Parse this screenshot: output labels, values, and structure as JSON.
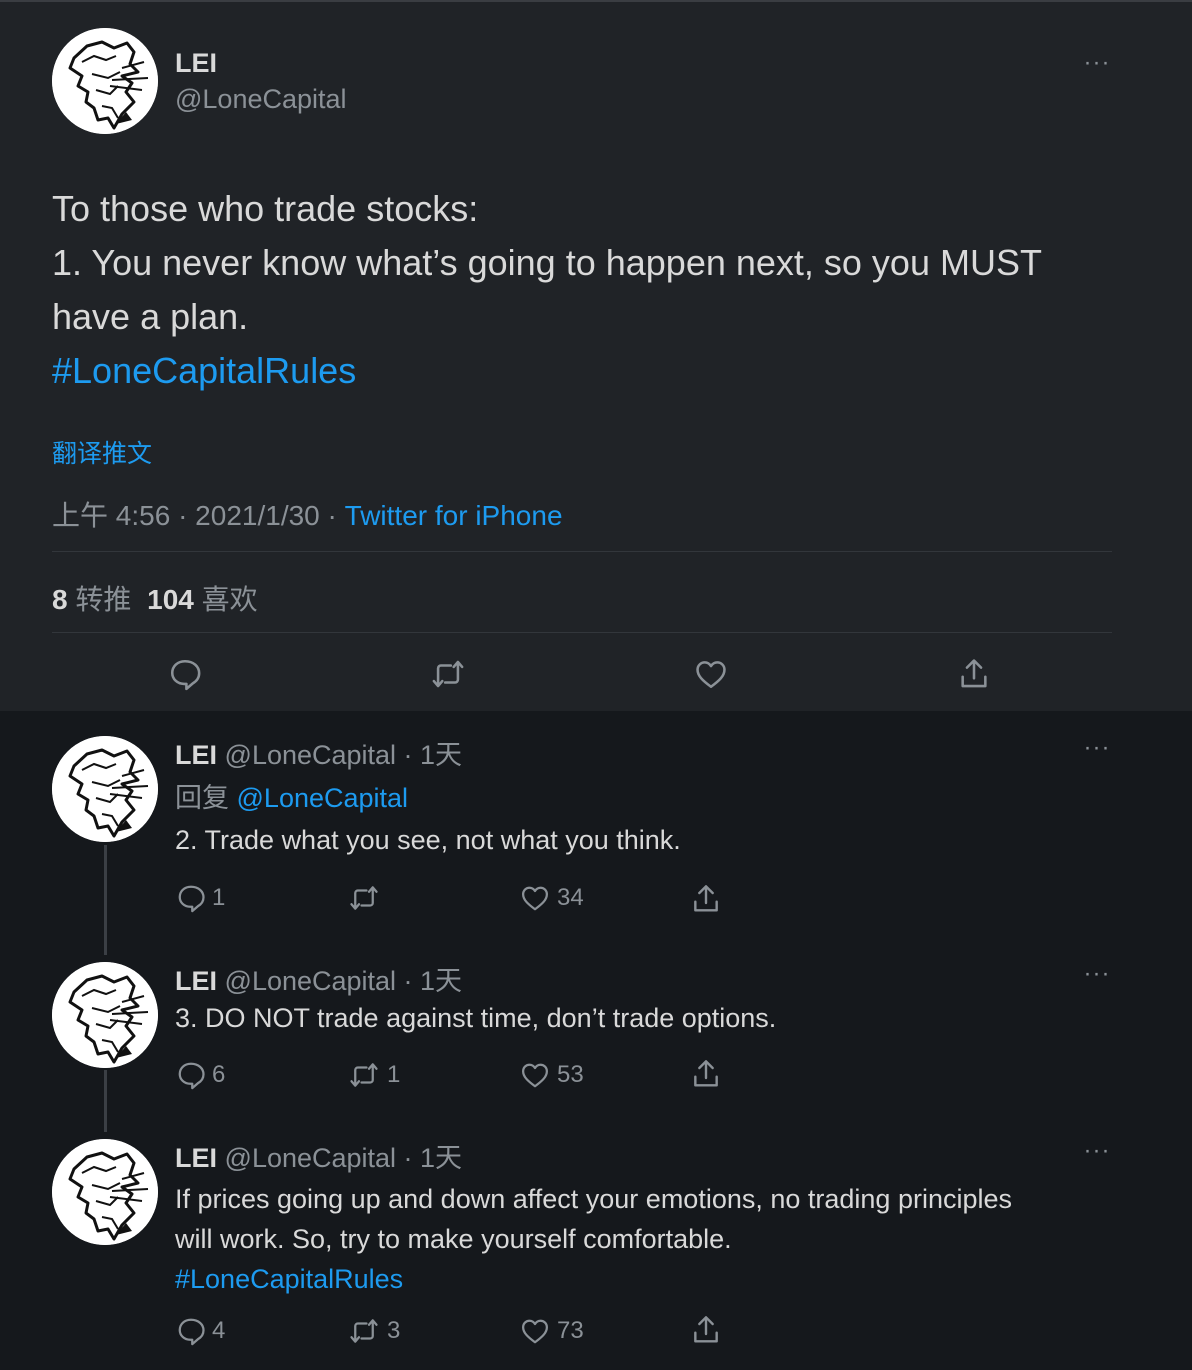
{
  "main_tweet": {
    "display_name": "LEI",
    "handle": "@LoneCapital",
    "text_lines": [
      "To those who trade stocks:",
      "1. You never know what’s going to happen next, so you MUST",
      "have a plan."
    ],
    "hashtag": "#LoneCapitalRules",
    "translate_label": "翻译推文",
    "time": "上午 4:56",
    "sep": "·",
    "date": "2021/1/30",
    "source": "Twitter for iPhone",
    "retweets_count": "8",
    "retweets_label": "转推",
    "likes_count": "104",
    "likes_label": "喜欢",
    "more": "···"
  },
  "replies": [
    {
      "display_name": "LEI",
      "meta": "@LoneCapital · 1天",
      "reply_prefix": "回复",
      "reply_to": "@LoneCapital",
      "text": "2. Trade what you see, not what you think.",
      "replies_count": "1",
      "retweets_count": "",
      "likes_count": "34",
      "more": "···"
    },
    {
      "display_name": "LEI",
      "meta": "@LoneCapital · 1天",
      "text": "3. DO NOT trade against time, don’t trade options.",
      "replies_count": "6",
      "retweets_count": "1",
      "likes_count": "53",
      "more": "···"
    },
    {
      "display_name": "LEI",
      "meta": "@LoneCapital · 1天",
      "text_line1": "If prices going up and down affect your emotions, no trading principles",
      "text_line2": "will work. So, try to make yourself comfortable.",
      "hashtag": "#LoneCapitalRules",
      "replies_count": "4",
      "retweets_count": "3",
      "likes_count": "73",
      "more": "···"
    }
  ],
  "colors": {
    "accent": "#1d9bf0",
    "main_bg": "#202327",
    "thread_bg": "#15181c",
    "muted": "#8b9197"
  },
  "icons": {
    "reply": "reply-icon",
    "retweet": "retweet-icon",
    "like": "heart-icon",
    "share": "share-icon",
    "more": "more-icon"
  }
}
